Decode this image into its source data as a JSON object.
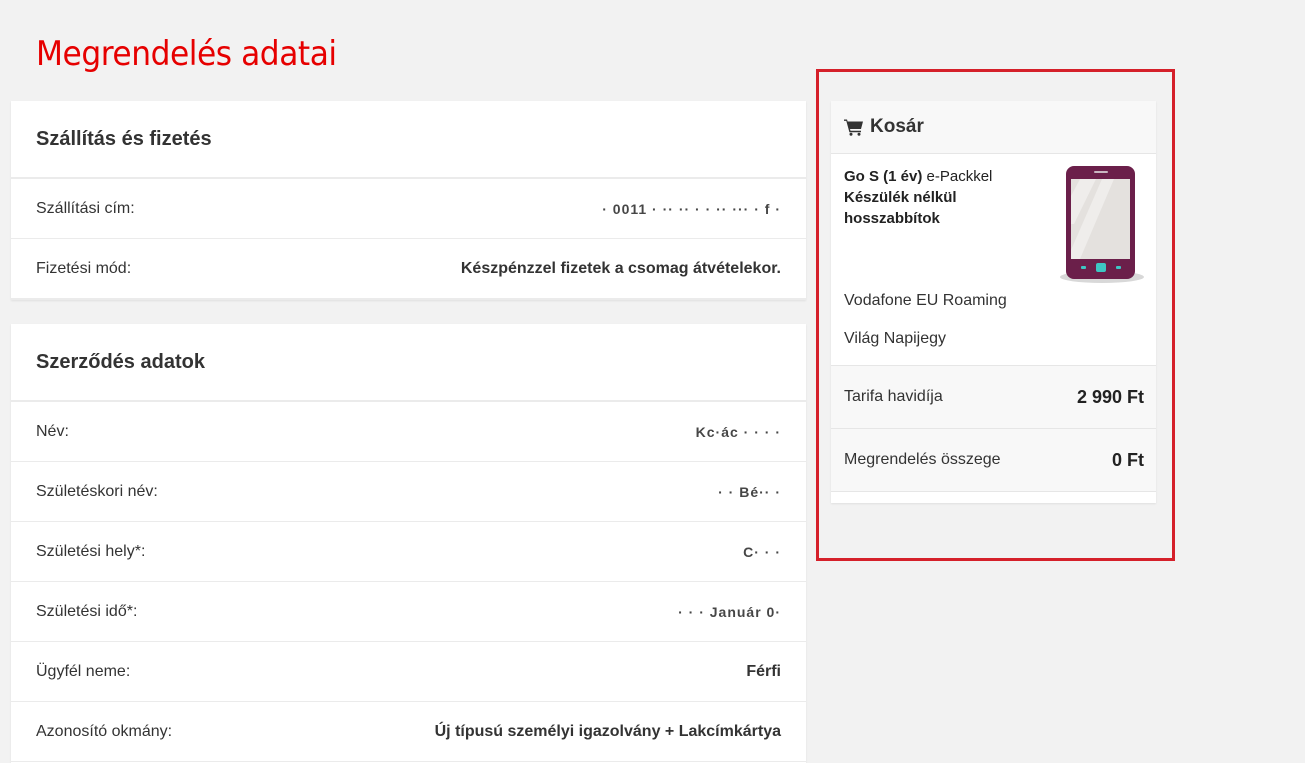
{
  "page": {
    "title": "Megrendelés adatai"
  },
  "shipping": {
    "heading": "Szállítás és fizetés",
    "rows": [
      {
        "label": "Szállítási cím:",
        "value": "· 0011 ·  ·· ·· ·  · ·· ··· · f ·"
      },
      {
        "label": "Fizetési mód:",
        "value": "Készpénzzel fizetek a csomag átvételekor."
      }
    ]
  },
  "contract": {
    "heading": "Szerződés adatok",
    "rows": [
      {
        "label": "Név:",
        "value": "Kc·ác  ·  · ·  ·"
      },
      {
        "label": "Születéskori név:",
        "value": "·  ·   Bé··  ·"
      },
      {
        "label": "Születési hely*:",
        "value": "C·  ·  ·"
      },
      {
        "label": "Születési idő*:",
        "value": "· · · Január 0·"
      },
      {
        "label": "Ügyfél neme:",
        "value": "Férfi"
      },
      {
        "label": "Azonosító okmány:",
        "value": "Új típusú személyi igazolvány + Lakcímkártya"
      }
    ]
  },
  "cart": {
    "heading": "Kosár",
    "icon": "shopping-cart-icon",
    "product": {
      "name_bold": "Go S (1 év)",
      "name_rest": " e-Packkel",
      "line2": "Készülék nélkül",
      "line3": "hosszabbítok",
      "image_icon": "smartphone-icon"
    },
    "addons": [
      "Vodafone EU Roaming",
      "Világ Napijegy"
    ],
    "monthly": {
      "label": "Tarifa havidíja",
      "amount": "2 990 Ft"
    },
    "total": {
      "label": "Megrendelés összege",
      "amount": "0 Ft"
    }
  },
  "colors": {
    "accent": "#e60000",
    "highlight": "#d5202a",
    "phone_body": "#6b1f4a"
  }
}
